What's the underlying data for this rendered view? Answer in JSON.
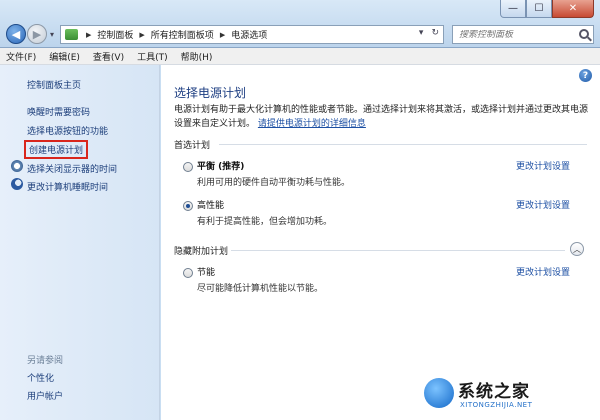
{
  "window": {
    "min_label": "—",
    "max_label": "☐",
    "close_label": "✕"
  },
  "address": {
    "crumbs": [
      "控制面板",
      "所有控制面板项",
      "电源选项"
    ],
    "refresh_glyph": "↻",
    "drop_glyph": "▾"
  },
  "search": {
    "placeholder": "搜索控制面板"
  },
  "menu": [
    "文件(F)",
    "编辑(E)",
    "查看(V)",
    "工具(T)",
    "帮助(H)"
  ],
  "sidebar": {
    "home": "控制面板主页",
    "items": [
      "唤醒时需要密码",
      "选择电源按钮的功能",
      "创建电源计划",
      "选择关闭显示器的时间",
      "更改计算机睡眠时间"
    ],
    "see_also_title": "另请参阅",
    "see_also": [
      "个性化",
      "用户帐户"
    ]
  },
  "main": {
    "title": "选择电源计划",
    "desc_text": "电源计划有助于最大化计算机的性能或者节能。通过选择计划来将其激活，或选择计划并通过更改其电源设置来自定义计划。",
    "desc_link": "请提供电源计划的详细信息",
    "preferred_label": "首选计划",
    "hidden_label": "隐藏附加计划",
    "change_label": "更改计划设置",
    "plans": [
      {
        "name": "平衡 (推荐)",
        "desc": "利用可用的硬件自动平衡功耗与性能。",
        "selected": false
      },
      {
        "name": "高性能",
        "desc": "有利于提高性能，但会增加功耗。",
        "selected": true
      },
      {
        "name": "节能",
        "desc": "尽可能降低计算机性能以节能。",
        "selected": false
      }
    ]
  },
  "watermark": {
    "title": "系统之家",
    "sub": "XITONGZHIJIA.NET"
  }
}
